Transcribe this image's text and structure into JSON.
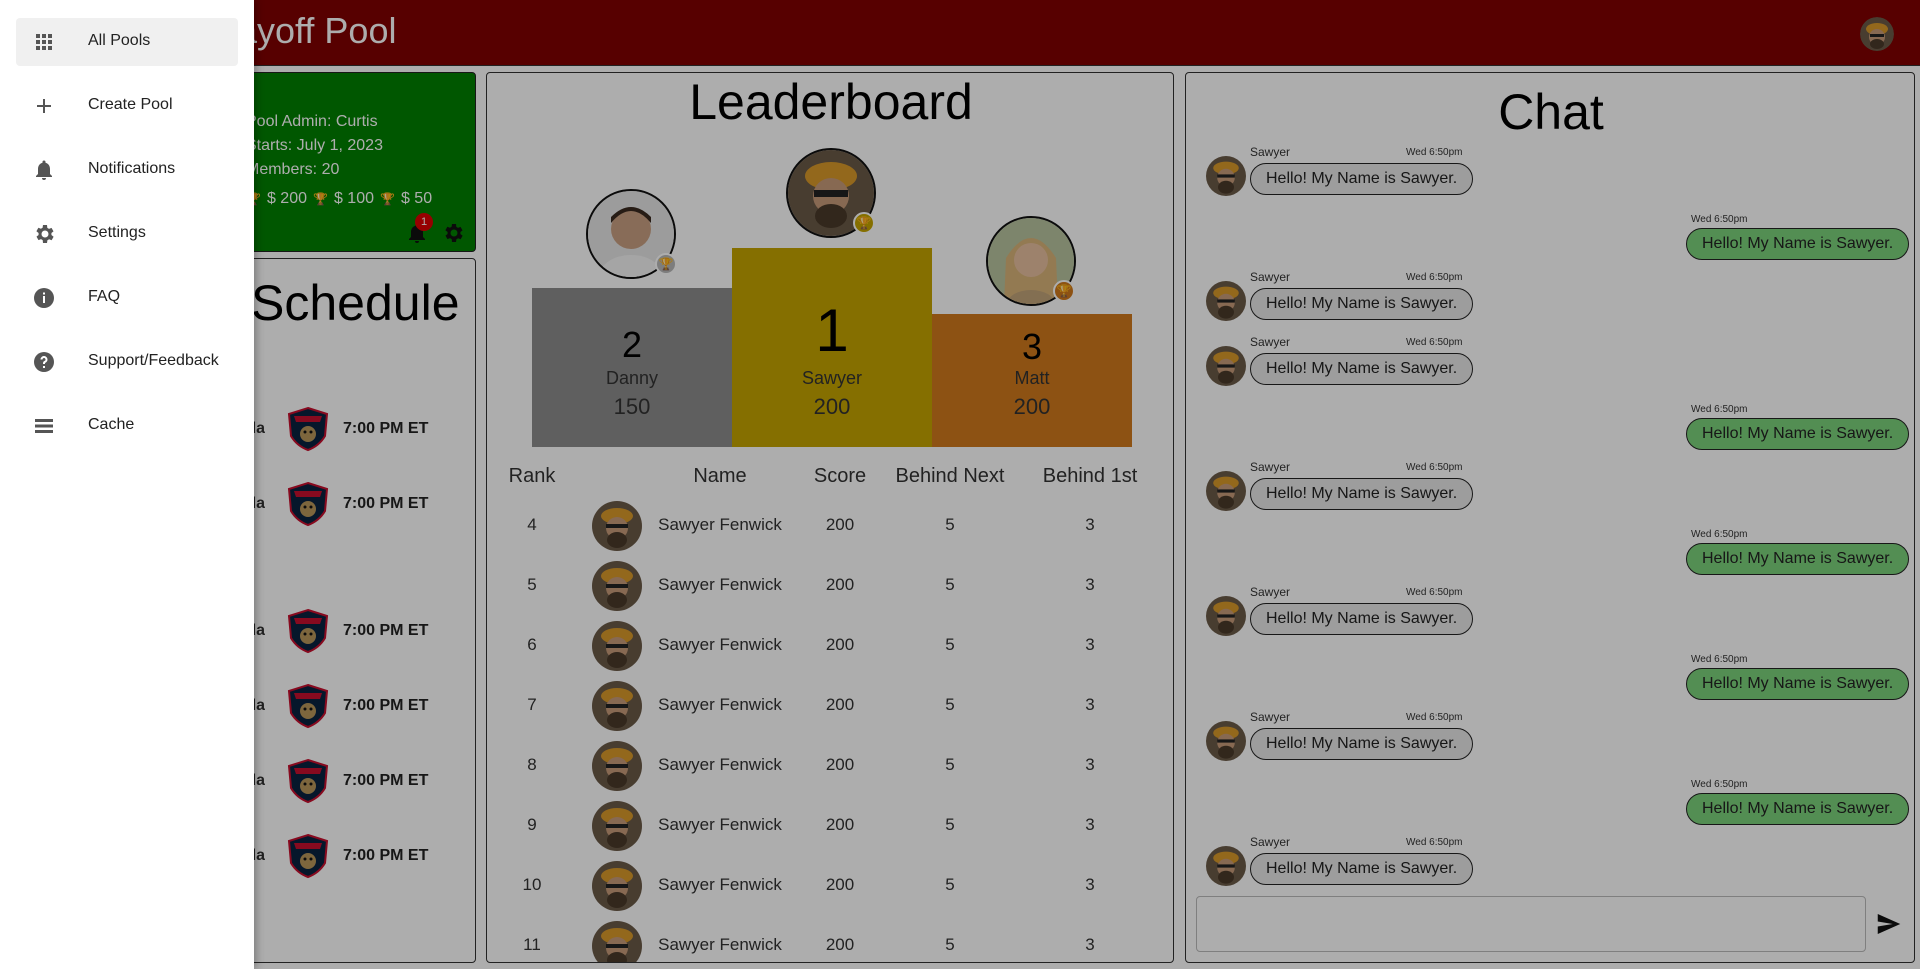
{
  "header": {
    "title": "Playoff Pool"
  },
  "info_card": {
    "admin": "Pool Admin: Curtis",
    "starts": "Starts: July 1, 2023",
    "members": "Members: 20",
    "prizes": [
      "$ 200",
      "$ 100",
      "$ 50"
    ],
    "notification_count": "1",
    "color": "#008000"
  },
  "schedule": {
    "title": "Schedule",
    "games": [
      {
        "team": "Florida",
        "time": "7:00 PM ET"
      },
      {
        "team": "Florida",
        "time": "7:00 PM ET"
      },
      {
        "team": "Florida",
        "time": "7:00 PM ET"
      },
      {
        "team": "Florida",
        "time": "7:00 PM ET"
      },
      {
        "team": "Florida",
        "time": "7:00 PM ET"
      },
      {
        "team": "Florida",
        "time": "7:00 PM ET"
      }
    ]
  },
  "leaderboard": {
    "title": "Leaderboard",
    "podium": [
      {
        "rank": "2",
        "name": "Danny",
        "score": "150",
        "color": "#8c8c8c"
      },
      {
        "rank": "1",
        "name": "Sawyer",
        "score": "200",
        "color": "#c4a400"
      },
      {
        "rank": "3",
        "name": "Matt",
        "score": "200",
        "color": "#d07a1c"
      }
    ],
    "columns": [
      "Rank",
      "Name",
      "Score",
      "Behind Next",
      "Behind 1st"
    ],
    "rows": [
      {
        "rank": "4",
        "name": "Sawyer Fenwick",
        "score": "200",
        "behind_next": "5",
        "behind_first": "3"
      },
      {
        "rank": "5",
        "name": "Sawyer Fenwick",
        "score": "200",
        "behind_next": "5",
        "behind_first": "3"
      },
      {
        "rank": "6",
        "name": "Sawyer Fenwick",
        "score": "200",
        "behind_next": "5",
        "behind_first": "3"
      },
      {
        "rank": "7",
        "name": "Sawyer Fenwick",
        "score": "200",
        "behind_next": "5",
        "behind_first": "3"
      },
      {
        "rank": "8",
        "name": "Sawyer Fenwick",
        "score": "200",
        "behind_next": "5",
        "behind_first": "3"
      },
      {
        "rank": "9",
        "name": "Sawyer Fenwick",
        "score": "200",
        "behind_next": "5",
        "behind_first": "3"
      },
      {
        "rank": "10",
        "name": "Sawyer Fenwick",
        "score": "200",
        "behind_next": "5",
        "behind_first": "3"
      },
      {
        "rank": "11",
        "name": "Sawyer Fenwick",
        "score": "200",
        "behind_next": "5",
        "behind_first": "3"
      }
    ]
  },
  "chat": {
    "title": "Chat",
    "messages": [
      {
        "dir": "in",
        "sender": "Sawyer",
        "time": "Wed 6:50pm",
        "text": "Hello! My Name is Sawyer."
      },
      {
        "dir": "out",
        "time": "Wed 6:50pm",
        "text": "Hello! My Name is Sawyer."
      },
      {
        "dir": "in",
        "sender": "Sawyer",
        "time": "Wed 6:50pm",
        "text": "Hello! My Name is Sawyer."
      },
      {
        "dir": "in",
        "sender": "Sawyer",
        "time": "Wed 6:50pm",
        "text": "Hello! My Name is Sawyer."
      },
      {
        "dir": "out",
        "time": "Wed 6:50pm",
        "text": "Hello! My Name is Sawyer."
      },
      {
        "dir": "in",
        "sender": "Sawyer",
        "time": "Wed 6:50pm",
        "text": "Hello! My Name is Sawyer."
      },
      {
        "dir": "out",
        "time": "Wed 6:50pm",
        "text": "Hello! My Name is Sawyer."
      },
      {
        "dir": "in",
        "sender": "Sawyer",
        "time": "Wed 6:50pm",
        "text": "Hello! My Name is Sawyer."
      },
      {
        "dir": "out",
        "time": "Wed 6:50pm",
        "text": "Hello! My Name is Sawyer."
      },
      {
        "dir": "in",
        "sender": "Sawyer",
        "time": "Wed 6:50pm",
        "text": "Hello! My Name is Sawyer."
      },
      {
        "dir": "out",
        "time": "Wed 6:50pm",
        "text": "Hello! My Name is Sawyer."
      },
      {
        "dir": "in",
        "sender": "Sawyer",
        "time": "Wed 6:50pm",
        "text": "Hello! My Name is Sawyer."
      }
    ],
    "input_value": ""
  },
  "drawer": {
    "items": [
      {
        "label": "All Pools",
        "icon": "apps-icon"
      },
      {
        "label": "Create Pool",
        "icon": "plus-icon"
      },
      {
        "label": "Notifications",
        "icon": "bell-icon"
      },
      {
        "label": "Settings",
        "icon": "gear-icon"
      },
      {
        "label": "FAQ",
        "icon": "info-icon"
      },
      {
        "label": "Support/Feedback",
        "icon": "help-icon"
      },
      {
        "label": "Cache",
        "icon": "storage-icon"
      }
    ]
  },
  "colors": {
    "header": "#800000",
    "chat_out_bubble": "#7bd17b",
    "chat_in_bubble": "#e8e8e8"
  }
}
